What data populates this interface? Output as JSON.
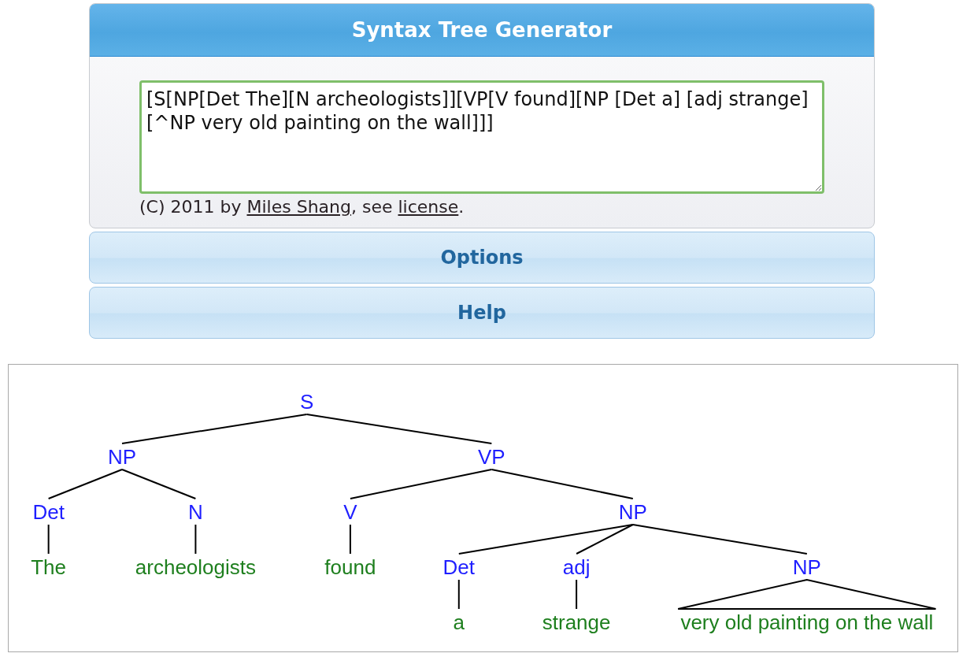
{
  "header": {
    "title": "Syntax Tree Generator"
  },
  "input": {
    "value": "[S[NP[Det The][N archeologists]][VP[V found][NP [Det a] [adj strange][^NP very old painting on the wall]]]"
  },
  "footer": {
    "prefix": "(C) 2011 by ",
    "author_link": "Miles Shang",
    "middle": ", see ",
    "license_link": "license",
    "suffix": "."
  },
  "sections": [
    {
      "label": "Options"
    },
    {
      "label": "Help"
    }
  ],
  "tree": {
    "label": "S",
    "kind": "phrase",
    "children": [
      {
        "label": "NP",
        "kind": "phrase",
        "children": [
          {
            "label": "Det",
            "kind": "phrase",
            "children": [
              {
                "label": "The",
                "kind": "word"
              }
            ]
          },
          {
            "label": "N",
            "kind": "phrase",
            "children": [
              {
                "label": "archeologists",
                "kind": "word"
              }
            ]
          }
        ]
      },
      {
        "label": "VP",
        "kind": "phrase",
        "children": [
          {
            "label": "V",
            "kind": "phrase",
            "children": [
              {
                "label": "found",
                "kind": "word"
              }
            ]
          },
          {
            "label": "NP",
            "kind": "phrase",
            "children": [
              {
                "label": "Det",
                "kind": "phrase",
                "children": [
                  {
                    "label": "a",
                    "kind": "word"
                  }
                ]
              },
              {
                "label": "adj",
                "kind": "phrase",
                "children": [
                  {
                    "label": "strange",
                    "kind": "word"
                  }
                ]
              },
              {
                "label": "NP",
                "kind": "phrase",
                "triangle": true,
                "children": [
                  {
                    "label": "very old painting on the wall",
                    "kind": "word"
                  }
                ]
              }
            ]
          }
        ]
      }
    ]
  }
}
